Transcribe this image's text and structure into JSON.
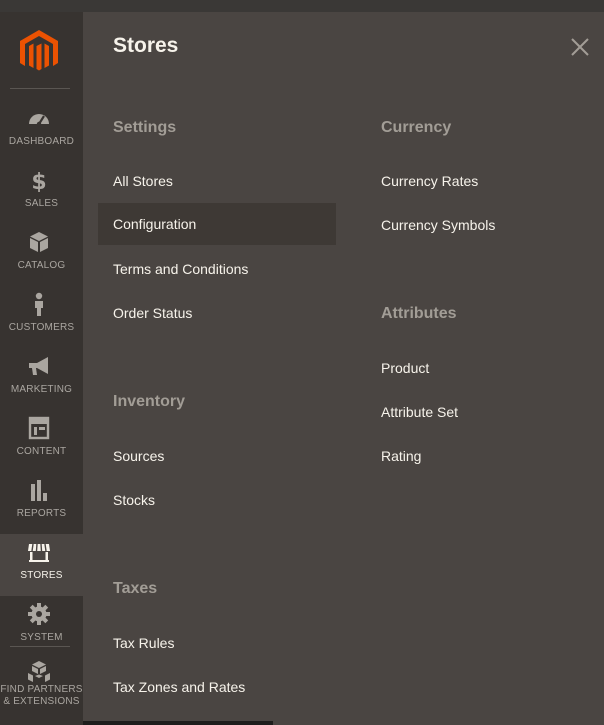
{
  "sidebar": {
    "items": [
      {
        "key": "dashboard",
        "label": "DASHBOARD",
        "icon": "dashboard-icon"
      },
      {
        "key": "sales",
        "label": "SALES",
        "icon": "dollar-icon"
      },
      {
        "key": "catalog",
        "label": "CATALOG",
        "icon": "box-icon"
      },
      {
        "key": "customers",
        "label": "CUSTOMERS",
        "icon": "person-icon"
      },
      {
        "key": "marketing",
        "label": "MARKETING",
        "icon": "megaphone-icon"
      },
      {
        "key": "content",
        "label": "CONTENT",
        "icon": "layout-icon"
      },
      {
        "key": "reports",
        "label": "REPORTS",
        "icon": "bar-chart-icon"
      },
      {
        "key": "stores",
        "label": "STORES",
        "icon": "storefront-icon",
        "active": true
      },
      {
        "key": "system",
        "label": "SYSTEM",
        "icon": "gear-icon"
      },
      {
        "key": "partners",
        "label": "FIND PARTNERS & EXTENSIONS",
        "icon": "boxes-icon"
      }
    ]
  },
  "panel": {
    "title": "Stores",
    "settings": {
      "title": "Settings",
      "links": [
        "All Stores",
        "Configuration",
        "Terms and Conditions",
        "Order Status"
      ]
    },
    "inventory": {
      "title": "Inventory",
      "links": [
        "Sources",
        "Stocks"
      ]
    },
    "taxes": {
      "title": "Taxes",
      "links": [
        "Tax Rules",
        "Tax Zones and Rates"
      ]
    },
    "currency": {
      "title": "Currency",
      "links": [
        "Currency Rates",
        "Currency Symbols"
      ]
    },
    "attributes": {
      "title": "Attributes",
      "links": [
        "Product",
        "Attribute Set",
        "Rating"
      ]
    }
  },
  "colors": {
    "brand": "#eb5202",
    "sidebar_bg": "#373330",
    "panel_bg": "#4a4542",
    "highlight_bg": "#3e3935",
    "link_text": "#f7f3eb",
    "section_text": "#a29d96"
  }
}
